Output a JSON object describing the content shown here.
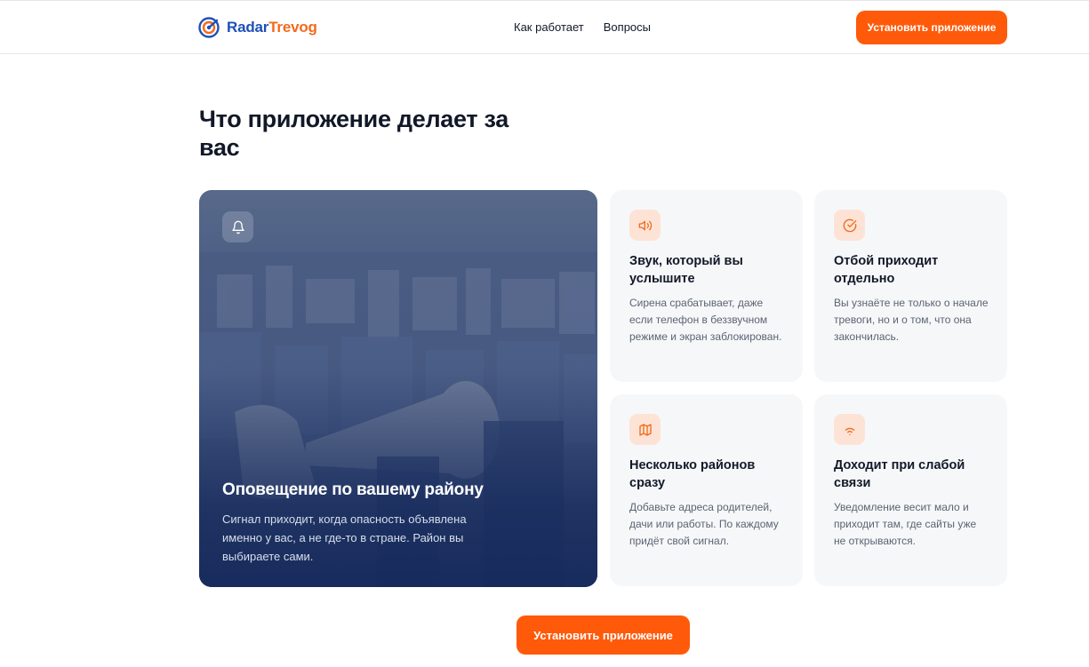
{
  "header": {
    "logo_part1": "Radar",
    "logo_part2": "Trevog",
    "nav": [
      "Как работает",
      "Вопросы"
    ],
    "install_button": "Установить приложение"
  },
  "section": {
    "title": "Что приложение делает за вас"
  },
  "hero_card": {
    "title": "Оповещение по вашему району",
    "text": "Сигнал приходит, когда опасность объявлена именно у вас, а не где-то в стране. Район вы выбираете сами."
  },
  "cards": [
    {
      "icon": "speaker-icon",
      "title": "Звук, который вы услышите",
      "text": "Сирена срабатывает, даже если телефон в беззвучном режиме и экран заблокирован."
    },
    {
      "icon": "check-circle-icon",
      "title": "Отбой приходит отдельно",
      "text": "Вы узнаёте не только о начале тревоги, но и о том, что она закончилась."
    },
    {
      "icon": "map-icon",
      "title": "Несколько районов сразу",
      "text": "Добавьте адреса родителей, дачи или работы. По каждому придёт свой сигнал."
    },
    {
      "icon": "wifi-icon",
      "title": "Доходит при слабой связи",
      "text": "Уведомление весит мало и приходит там, где сайты уже не открываются."
    }
  ],
  "cta_button": "Установить приложение",
  "colors": {
    "accent": "#ff5a0a",
    "brand_blue": "#1f4fb8",
    "brand_orange": "#f26a1b",
    "card_bg": "#f6f7f9",
    "icon_bg": "#fde3d6"
  }
}
